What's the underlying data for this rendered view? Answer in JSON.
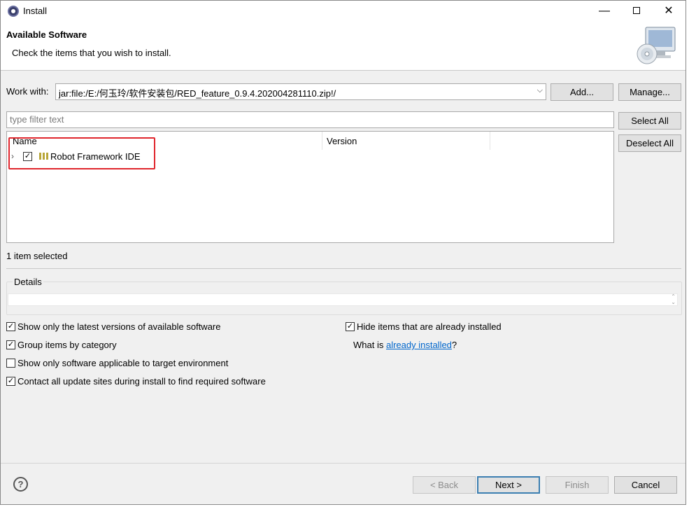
{
  "window": {
    "title": "Install",
    "minimize": "—",
    "close": "✕"
  },
  "banner": {
    "title": "Available Software",
    "description": "Check the items that you wish to install."
  },
  "work_with": {
    "label": "Work with:",
    "value": "jar:file:/E:/何玉玲/软件安装包/RED_feature_0.9.4.202004281110.zip!/",
    "add_label": "Add...",
    "manage_label": "Manage..."
  },
  "filter": {
    "placeholder": "type filter text"
  },
  "buttons": {
    "select_all": "Select All",
    "deselect_all": "Deselect All"
  },
  "table": {
    "columns": [
      "Name",
      "Version"
    ],
    "rows": [
      {
        "name": "Robot Framework IDE",
        "version": "",
        "checked": true,
        "expand_icon": "chevron-right-icon"
      }
    ]
  },
  "status": {
    "selection": "1 item selected"
  },
  "details": {
    "label": "Details",
    "value": ""
  },
  "options": {
    "latest_versions": {
      "label": "Show only the latest versions of available software",
      "checked": true
    },
    "group_by_category": {
      "label": "Group items by category",
      "checked": true
    },
    "applicable_only": {
      "label": "Show only software applicable to target environment",
      "checked": false
    },
    "contact_sites": {
      "label": "Contact all update sites during install to find required software",
      "checked": true
    },
    "hide_installed": {
      "label": "Hide items that are already installed",
      "checked": true
    },
    "what_is_prefix": "What is ",
    "what_is_link": "already installed",
    "what_is_suffix": "?"
  },
  "footer": {
    "help": "?",
    "back": "< Back",
    "next": "Next >",
    "finish": "Finish",
    "cancel": "Cancel"
  },
  "colors": {
    "highlight_border": "#e0262d",
    "link": "#0066cc",
    "default_button_border": "#3c7fb1"
  }
}
